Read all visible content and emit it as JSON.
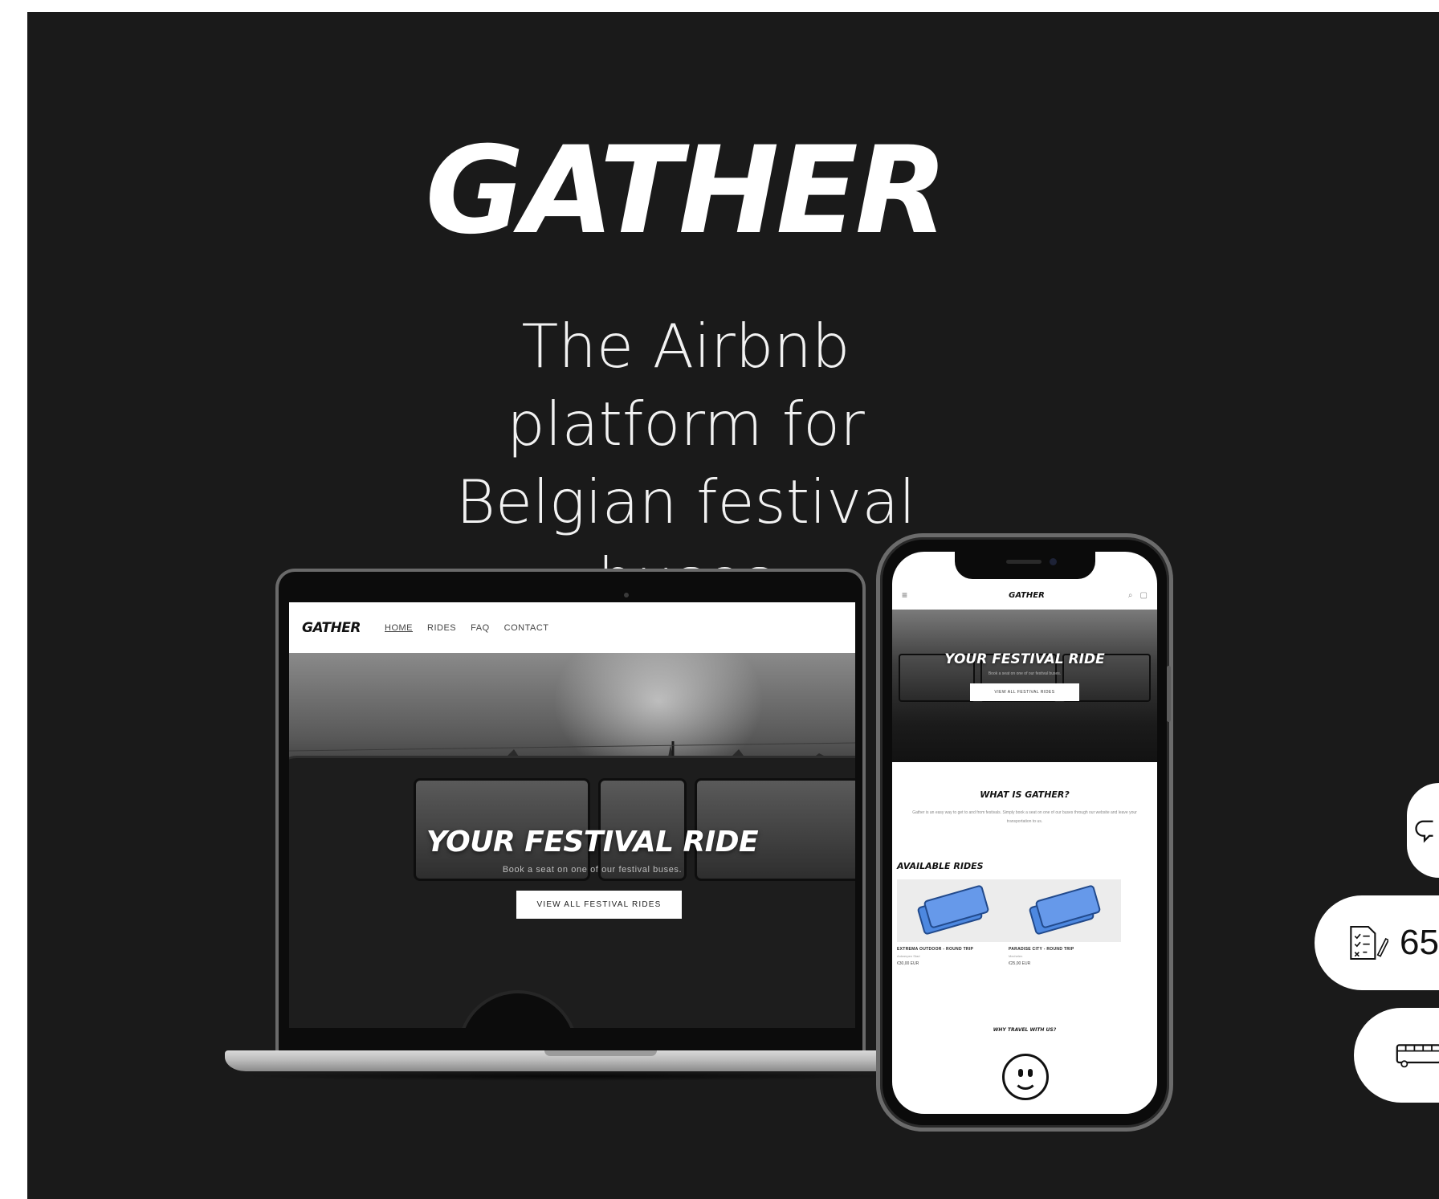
{
  "header": {
    "logo": "GATHER",
    "tagline_line1": "The Airbnb platform for",
    "tagline_line2": "Belgian festival buses"
  },
  "laptop_site": {
    "logo": "GATHER",
    "nav": [
      "HOME",
      "RIDES",
      "FAQ",
      "CONTACT"
    ],
    "hero_title": "YOUR FESTIVAL RIDE",
    "hero_subtitle": "Book a seat on one of our festival buses.",
    "hero_button": "VIEW ALL FESTIVAL RIDES"
  },
  "phone_site": {
    "logo": "GATHER",
    "menu_icon": "≡",
    "search_icon": "⌕",
    "cart_icon": "▢",
    "hero_title": "YOUR FESTIVAL RIDE",
    "hero_subtitle": "Book a seat on one of our festival buses.",
    "hero_button": "VIEW ALL FESTIVAL RIDES",
    "what_title": "WHAT IS GATHER?",
    "what_text": "Gather is an easy way to get to and from festivals. Simply book a seat on one of our buses through our website and leave your transportation to us.",
    "available_title": "AVAILABLE RIDES",
    "rides": [
      {
        "title": "EXTREMA OUTDOOR - ROUND TRIP",
        "meta": "Antwerpen Stad",
        "price": "€30,00 EUR"
      },
      {
        "title": "PARADISE CITY - ROUND TRIP",
        "meta": "Mechelen",
        "price": "€25,00 EUR"
      }
    ],
    "why_title": "WHY TRAVEL WITH US?"
  },
  "pills": {
    "stat_value": "65",
    "icons": [
      "chat-bubbles-icon",
      "checklist-icon",
      "bus-icon"
    ]
  }
}
